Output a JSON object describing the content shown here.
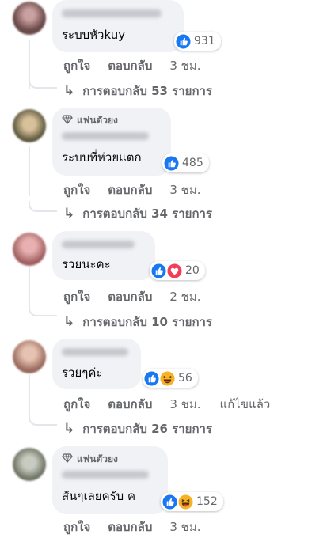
{
  "comments": [
    {
      "badge": "",
      "text": "ระบบหัวkuy",
      "reactions": [
        "like"
      ],
      "count": "931",
      "actions": {
        "like": "ถูกใจ",
        "reply": "ตอบกลับ",
        "time": "3 ชม.",
        "edited": ""
      },
      "replies": "การตอบกลับ 53 รายการ",
      "avatar_color": "#6b4a4a"
    },
    {
      "badge": "แฟนตัวยง",
      "text": "ระบบที่ห่วยแตก",
      "reactions": [
        "like"
      ],
      "count": "485",
      "actions": {
        "like": "ถูกใจ",
        "reply": "ตอบกลับ",
        "time": "3 ชม.",
        "edited": ""
      },
      "replies": "การตอบกลับ 34 รายการ",
      "avatar_color": "#8a7a55"
    },
    {
      "badge": "",
      "text": "รวยนะคะ",
      "reactions": [
        "like",
        "love"
      ],
      "count": "20",
      "actions": {
        "like": "ถูกใจ",
        "reply": "ตอบกลับ",
        "time": "2 ชม.",
        "edited": ""
      },
      "replies": "การตอบกลับ 10 รายการ",
      "avatar_color": "#b07070"
    },
    {
      "badge": "",
      "text": "รวยๆค่ะ",
      "reactions": [
        "like",
        "haha"
      ],
      "count": "56",
      "actions": {
        "like": "ถูกใจ",
        "reply": "ตอบกลับ",
        "time": "3 ชม.",
        "edited": "แก้ไขแล้ว"
      },
      "replies": "การตอบกลับ 26 รายการ",
      "avatar_color": "#c08878"
    },
    {
      "badge": "แฟนตัวยง",
      "text": "สันๆเลยครับ ค",
      "reactions": [
        "like",
        "haha"
      ],
      "count": "152",
      "actions": {
        "like": "ถูกใจ",
        "reply": "ตอบกลับ",
        "time": "3 ชม.",
        "edited": ""
      },
      "replies": "",
      "avatar_color": "#7a8070"
    }
  ],
  "colors": {
    "like": "#1877f2",
    "love": "#f33e58",
    "haha": "#f7b125",
    "muted": "#65676b",
    "bubble": "#f0f2f5"
  }
}
